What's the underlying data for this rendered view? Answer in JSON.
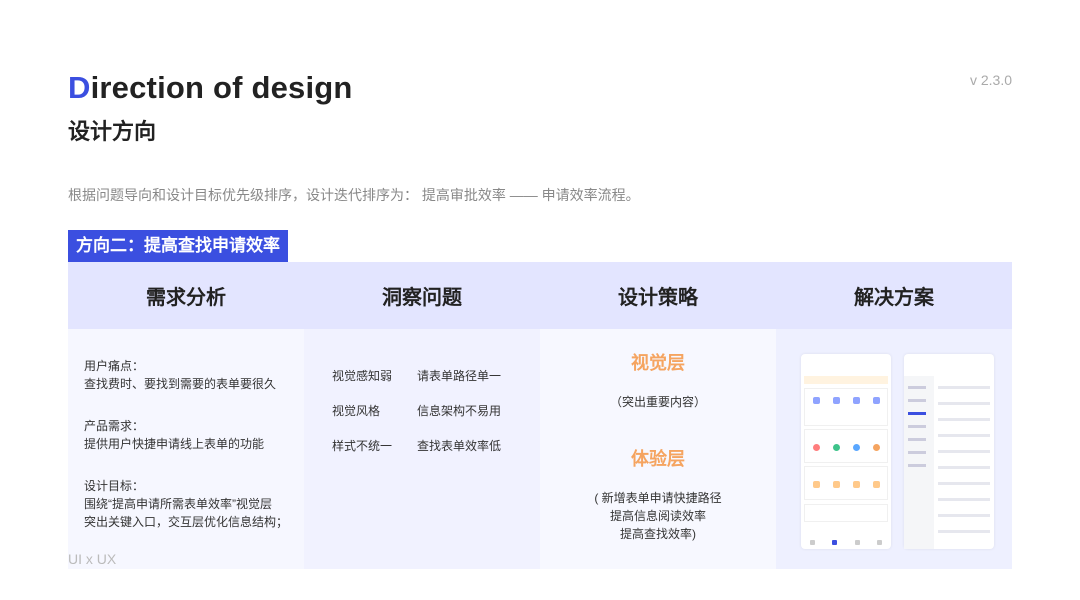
{
  "header": {
    "title_accent": "D",
    "title_rest": "irection of design",
    "subtitle": "设计方向",
    "version": "v 2.3.0"
  },
  "summary": "根据问题导向和设计目标优先级排序，设计迭代排序为： 提高审批效率 —— 申请效率流程。",
  "section_tag": "方向二：提高查找申请效率",
  "table": {
    "headers": [
      "需求分析",
      "洞察问题",
      "设计策略",
      "解决方案"
    ],
    "needs": [
      {
        "label": "用户痛点：",
        "text": "查找费时、要找到需要的表单要很久"
      },
      {
        "label": "产品需求：",
        "text": "提供用户快捷申请线上表单的功能"
      },
      {
        "label": "设计目标：",
        "text": "围绕“提高申请所需表单效率”视觉层",
        "text2": "突出关键入口，交互层优化信息结构；"
      }
    ],
    "insights": [
      [
        "视觉感知弱",
        "请表单路径单一"
      ],
      [
        "视觉风格",
        "信息架构不易用"
      ],
      [
        "样式不统一",
        "查找表单效率低"
      ]
    ],
    "strategies": [
      {
        "title": "视觉层",
        "lines": [
          "（突出重要内容）"
        ]
      },
      {
        "title": "体验层",
        "lines": [
          "( 新增表单申请快捷路径",
          "提高信息阅读效率",
          "提高查找效率)"
        ]
      }
    ],
    "colors": {
      "accent": "#3b4fe0",
      "header_bg": "#e3e5ff",
      "strategy_title": "#f5a460"
    }
  },
  "footer": "UI x UX"
}
